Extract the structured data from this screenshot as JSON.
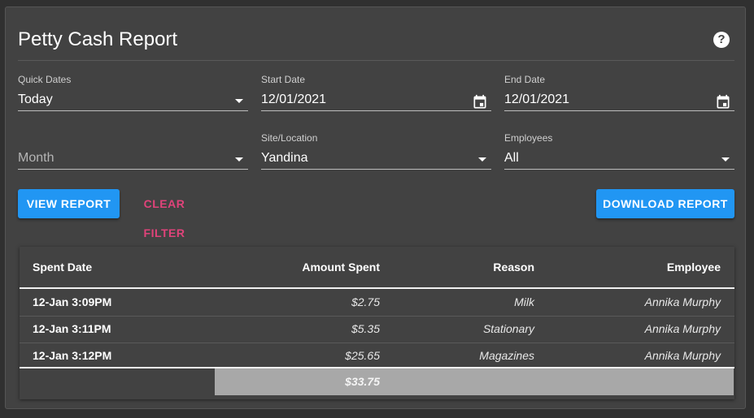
{
  "header": {
    "title": "Petty Cash Report",
    "help_icon": "?"
  },
  "filters": {
    "quick_dates": {
      "label": "Quick Dates",
      "value": "Today"
    },
    "start_date": {
      "label": "Start Date",
      "value": "12/01/2021"
    },
    "end_date": {
      "label": "End Date",
      "value": "12/01/2021"
    },
    "month": {
      "placeholder": "Month"
    },
    "site": {
      "label": "Site/Location",
      "value": "Yandina"
    },
    "employees": {
      "label": "Employees",
      "value": "All"
    }
  },
  "actions": {
    "view_report": "VIEW REPORT",
    "clear_filter": "CLEAR FILTER",
    "download_report": "DOWNLOAD REPORT"
  },
  "table": {
    "columns": [
      "Spent Date",
      "Amount Spent",
      "Reason",
      "Employee"
    ],
    "rows": [
      {
        "date": "12-Jan 3:09PM",
        "amount": "$2.75",
        "reason": "Milk",
        "employee": "Annika Murphy"
      },
      {
        "date": "12-Jan 3:11PM",
        "amount": "$5.35",
        "reason": "Stationary",
        "employee": "Annika Murphy"
      },
      {
        "date": "12-Jan 3:12PM",
        "amount": "$25.65",
        "reason": "Magazines",
        "employee": "Annika Murphy"
      }
    ],
    "total": "$33.75"
  },
  "colors": {
    "background": "#303030",
    "card": "#424242",
    "primary": "#2196f3",
    "accent": "#e0437a",
    "total_bar": "#a8a8a8"
  }
}
